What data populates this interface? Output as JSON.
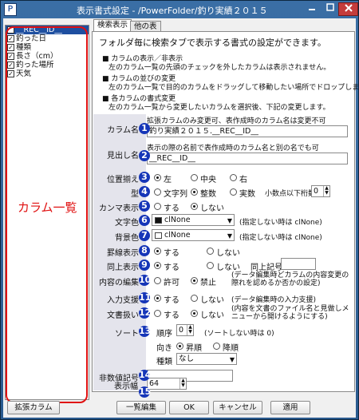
{
  "window": {
    "title": "表示書式設定 - /PowerFolder/釣り実績２０１５",
    "icon_text": "Ｐ"
  },
  "column_list": {
    "items": [
      {
        "label": "__REC__ID__",
        "checked": true,
        "selected": true
      },
      {
        "label": "釣った日",
        "checked": true
      },
      {
        "label": "種類",
        "checked": true
      },
      {
        "label": "長さ（cm）",
        "checked": true
      },
      {
        "label": "釣った場所",
        "checked": true
      },
      {
        "label": "天気",
        "checked": true
      }
    ],
    "annotation": "カラム一覧"
  },
  "tabs": [
    {
      "label": "検索表示",
      "active": true
    },
    {
      "label": "他の表",
      "active": false
    }
  ],
  "description": {
    "intro": "フォルダ毎に検索タブで表示する書式の設定ができます。",
    "items": [
      {
        "heading": "■ カラムの表示／非表示",
        "text": "左のカラム一覧の先頭のチェックを外したカラムは表示されません。"
      },
      {
        "heading": "■ カラムの並びの変更",
        "text": "左のカラム一覧で目的のカラムをドラッグして移動したい場所でドロップします。"
      },
      {
        "heading": "■ 各カラムの書式変更",
        "text": "左のカラム一覧から変更したいカラムを選択後、下記の変更します。"
      }
    ]
  },
  "form": {
    "column_name": {
      "label": "カラム名",
      "note": "拡張カラムのみ変更可、表作成時のカラム名は変更不可",
      "value": "釣り実績２０１５.__REC__ID__"
    },
    "header_name": {
      "label": "見出し名",
      "note": "表示の際の名前で表作成時のカラム名と別の名でも可",
      "value": "__REC__ID__"
    },
    "alignment": {
      "label": "位置揃え",
      "options": [
        "左",
        "中央",
        "右"
      ],
      "selected": 0
    },
    "type": {
      "label": "型",
      "options": [
        "文字列",
        "整数",
        "実数"
      ],
      "selected": 1,
      "decimal_label": "小数点以下桁数",
      "decimal_value": "0"
    },
    "comma": {
      "label": "カンマ表示",
      "options": [
        "する",
        "しない"
      ],
      "selected": 1
    },
    "text_color": {
      "label": "文字色",
      "value": "clNone",
      "note": "(指定しない時は clNone)",
      "swatch": "#111111"
    },
    "back_color": {
      "label": "背景色",
      "value": "clNone",
      "note": "(指定しない時は clNone)",
      "swatch": "#ffffff"
    },
    "ruled_line": {
      "label": "罫線表示",
      "options": [
        "する",
        "しない"
      ],
      "selected": 0
    },
    "same_above": {
      "label": "同上表示",
      "options": [
        "する",
        "しない"
      ],
      "selected": 0,
      "symbol_label": "同上記号",
      "symbol_value": ""
    },
    "edit_content": {
      "label": "内容の編集",
      "options": [
        "許可",
        "禁止"
      ],
      "selected": 1,
      "note": "(データ編集時どカラムの内容変更の際れを認めるか否かの設定)"
    },
    "input_support": {
      "label": "入力支援",
      "options": [
        "する",
        "しない"
      ],
      "selected": 0,
      "note": "(データ編集時の入力支援)"
    },
    "doc_handling": {
      "label": "文書扱い",
      "options": [
        "する",
        "しない"
      ],
      "selected": 1,
      "note": "(内容を文書のファイル名と見做しメニューから開けるようにする)"
    },
    "sort": {
      "label": "ソート",
      "order_label": "順序",
      "order_value": "0",
      "order_note": "(ソートしない時は 0)",
      "direction_label": "向き",
      "direction_options": [
        "昇順",
        "降順"
      ],
      "direction_selected": 0,
      "kind_label": "種類",
      "kind_value": "なし"
    },
    "null_symbol": {
      "label": "非数値記号",
      "value": ""
    },
    "display_width": {
      "label": "表示幅",
      "value": "64"
    }
  },
  "markers": [
    "1",
    "2",
    "3",
    "4",
    "5",
    "6",
    "7",
    "8",
    "9",
    "10",
    "11",
    "12",
    "13",
    "14",
    "15"
  ],
  "buttons": {
    "ext_column": "拡張カラム",
    "list_edit": "一覧編集",
    "ok": "OK",
    "cancel": "キャンセル",
    "apply": "適用"
  },
  "colors": {
    "accent_marker": "#1636b8",
    "annotation_red": "#e01010",
    "selection": "#1e4fa0"
  }
}
